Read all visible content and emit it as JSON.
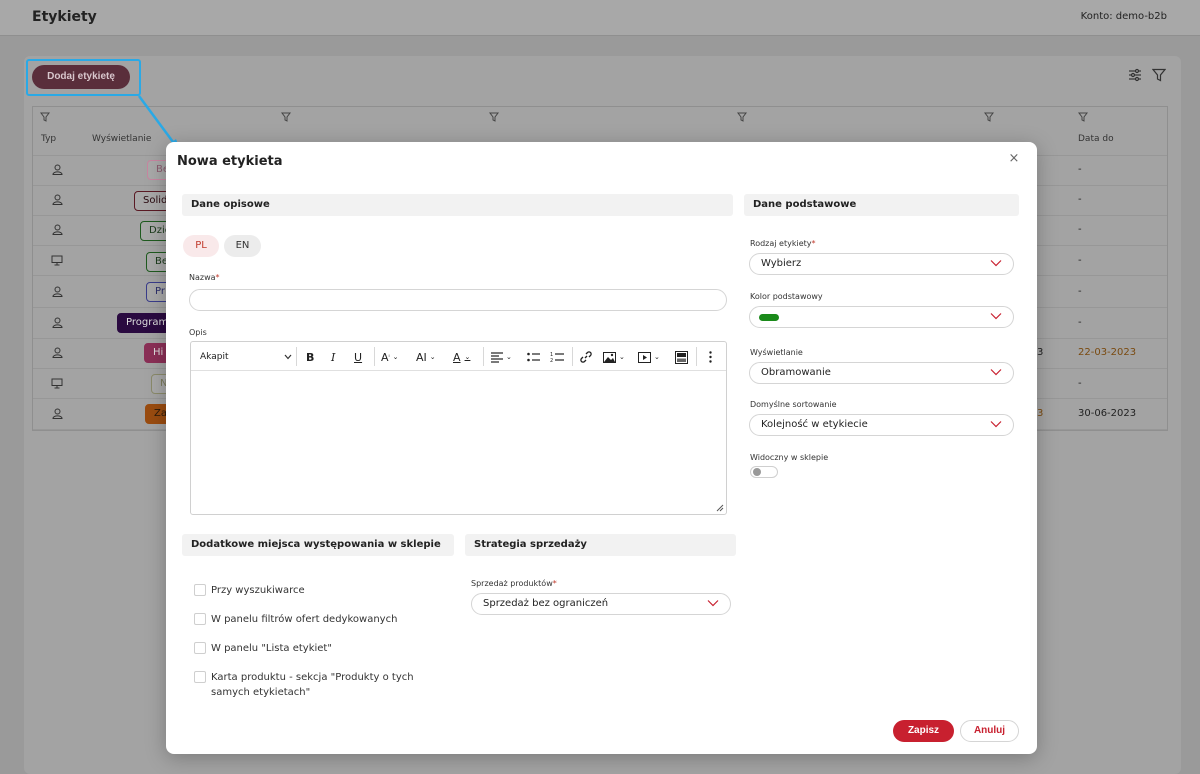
{
  "app": {
    "title": "Etykiety",
    "account": "Konto: demo-b2b"
  },
  "toolbar": {
    "add_label": "Dodaj etykietę"
  },
  "table": {
    "headers": [
      "Typ",
      "Wyświetlanie",
      "Data do"
    ],
    "chips": [
      {
        "text": "Be",
        "color": "#c785a0"
      },
      {
        "text": "Solid",
        "color": "#7a1f2e"
      },
      {
        "text": "Dzie",
        "color": "#2b8a2b"
      },
      {
        "text": "Be",
        "color": "#2b8a2b"
      },
      {
        "text": "Pr",
        "color": "#5b5fc7"
      },
      {
        "text": "Program",
        "color": "#3b0a57"
      },
      {
        "text": "Hi",
        "color": "#c2437a"
      },
      {
        "text": "N",
        "color": "#c8c8a0"
      },
      {
        "text": "Za",
        "color": "#d96b14"
      }
    ],
    "date_to": [
      "-",
      "-",
      "-",
      "-",
      "-",
      "-",
      "22-03-2023",
      "-",
      "30-06-2023"
    ],
    "partial_3": "3",
    "partial_3b": "3"
  },
  "modal": {
    "title": "Nowa etykieta",
    "close": "×",
    "sections": {
      "descriptive": "Dane opisowe",
      "basic": "Dane podstawowe",
      "extra_places": "Dodatkowe miejsca występowania w sklepie",
      "strategy": "Strategia sprzedaży"
    },
    "languages": [
      "PL",
      "EN"
    ],
    "name_label": "Nazwa",
    "required_mark": "*",
    "name_value": "",
    "desc_label": "Opis",
    "editor": {
      "paragraph": "Akapit"
    },
    "label_type": {
      "label": "Rodzaj etykiety",
      "value": "Wybierz"
    },
    "base_color": {
      "label": "Kolor podstawowy",
      "color": "#1a8a1a"
    },
    "display": {
      "label": "Wyświetlanie",
      "value": "Obramowanie"
    },
    "sorting": {
      "label": "Domyślne sortowanie",
      "value": "Kolejność w etykiecie"
    },
    "visible": {
      "label": "Widoczny w sklepie",
      "on": false
    },
    "checkboxes": [
      "Przy wyszukiwarce",
      "W panelu filtrów ofert dedykowanych",
      "W panelu \"Lista etykiet\"",
      "Karta produktu - sekcja \"Produkty o tych samych etykietach\""
    ],
    "sales": {
      "label": "Sprzedaż produktów",
      "value": "Sprzedaż bez ograniczeń"
    },
    "save": "Zapisz",
    "cancel": "Anuluj"
  },
  "colors": {
    "accent": "#c8202f",
    "highlight": "#2aa9e6"
  }
}
